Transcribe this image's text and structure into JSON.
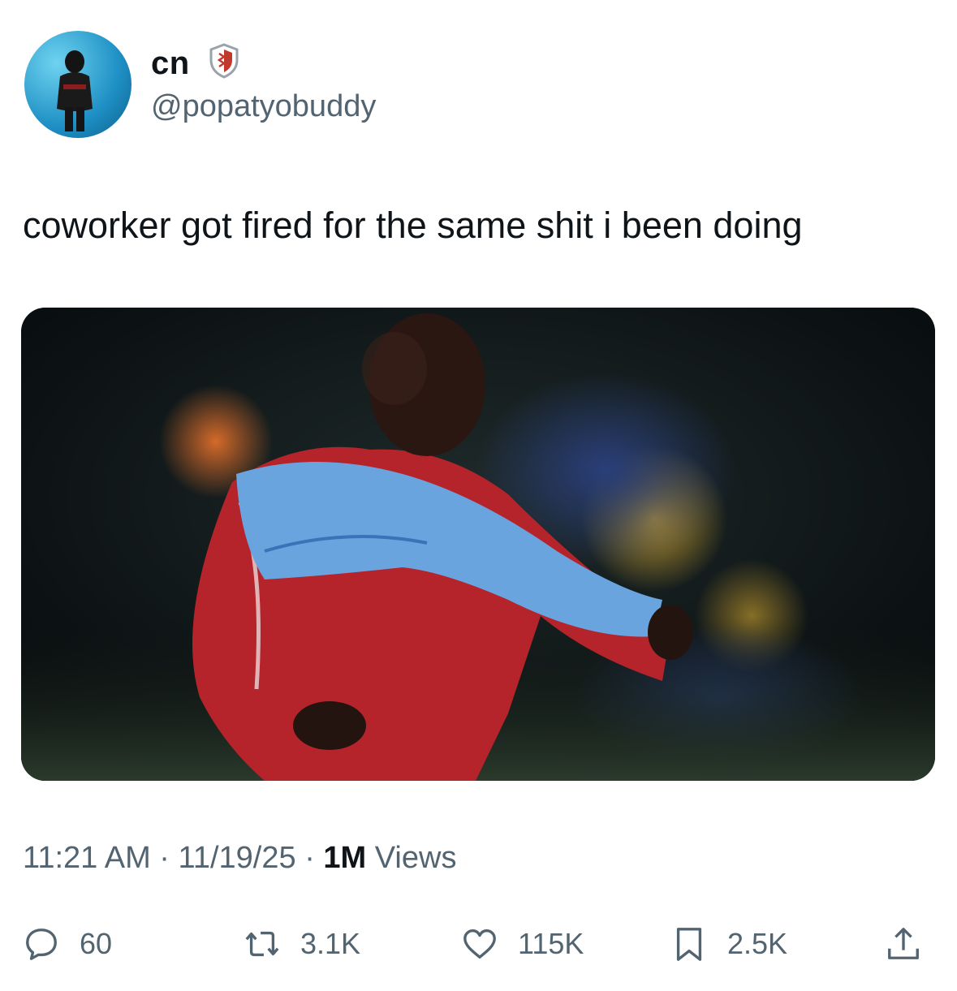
{
  "author": {
    "display_name": "cn",
    "handle": "@popatyobuddy"
  },
  "tweet": {
    "text": "coworker got fired for the same shit i been doing"
  },
  "meta": {
    "time": "11:21 AM",
    "date": "11/19/25",
    "sep": "·",
    "views_count": "1M",
    "views_label": "Views"
  },
  "actions": {
    "replies": "60",
    "reposts": "3.1K",
    "likes": "115K",
    "bookmarks": "2.5K"
  },
  "icons": [
    "avatar",
    "verified-shield-icon",
    "reply-icon",
    "repost-icon",
    "like-icon",
    "bookmark-icon",
    "share-icon"
  ],
  "colors": {
    "text": "#0f1419",
    "secondary": "#536471",
    "badge": "#c0392b"
  }
}
